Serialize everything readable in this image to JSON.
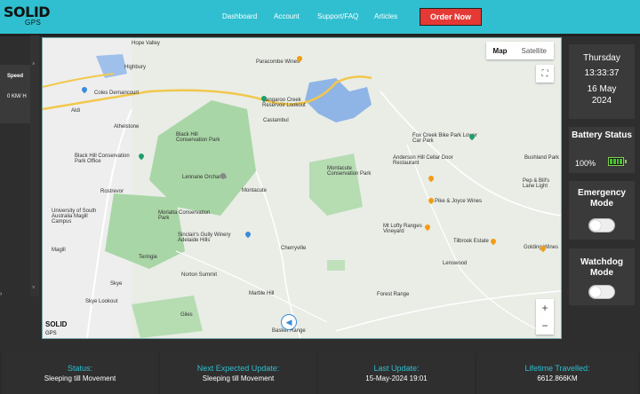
{
  "header": {
    "logo_big": "SOLID",
    "logo_small": "GPS",
    "nav": [
      "Dashboard",
      "Account",
      "Support/FAQ",
      "Articles"
    ],
    "order_button": "Order Now"
  },
  "left_panel": {
    "speed_label": "Speed",
    "speed_value": "0 KM/ H"
  },
  "map": {
    "toggle_map": "Map",
    "toggle_satellite": "Satellite",
    "zoom_in": "+",
    "zoom_out": "−",
    "labels": [
      "Hope Valley",
      "Highbury",
      "Coles Dernancourt",
      "Athelstone",
      "Paracombe Wines",
      "Kangaroo Creek Reservoir Lookout",
      "Castambul",
      "Black Hill Conservation Park",
      "Black Hill Conservation Park Office",
      "Lennane Orchards",
      "Montacute",
      "Montacute Conservation Park",
      "Rostrevor",
      "University of South Australia Magill Campus",
      "Morialta Conservation Park",
      "Sinclair's Gully Winery Adelaide Hills",
      "Magill",
      "Teringie",
      "Cherryville",
      "Norton Summit",
      "Marble Hill",
      "Skye",
      "Skye Lookout",
      "Giles",
      "Basket Range",
      "Fox Creek Bike Park Lower Car Park",
      "Anderson Hill Cellar Door Restaurant",
      "Pike & Joyce Wines",
      "Mt Lofty Ranges Vineyard",
      "Tilbrook Estate",
      "Golding Wines",
      "Lenswood",
      "Forest Range",
      "Bushland Park",
      "Pep & Bill's Lane Light",
      "Aldi"
    ]
  },
  "datetime": {
    "day": "Thursday",
    "time": "13:33:37",
    "date": "16 May 2024"
  },
  "battery": {
    "title": "Battery Status",
    "percent": "100%",
    "level": 1.0
  },
  "emergency": {
    "title": "Emergency Mode",
    "enabled": false
  },
  "watchdog": {
    "title": "Watchdog Mode",
    "enabled": false
  },
  "status": [
    {
      "label": "Status:",
      "value": "Sleeping till Movement"
    },
    {
      "label": "Next Expected Update:",
      "value": "Sleeping till Movement"
    },
    {
      "label": "Last Update:",
      "value": "15-May-2024 19:01"
    },
    {
      "label": "Lifetime Travelled:",
      "value": "6612.866KM"
    }
  ],
  "colors": {
    "header": "#2fbfd0",
    "order_button": "#e53935",
    "accent_text": "#2fbfd0",
    "battery_green": "#4cbf30"
  }
}
